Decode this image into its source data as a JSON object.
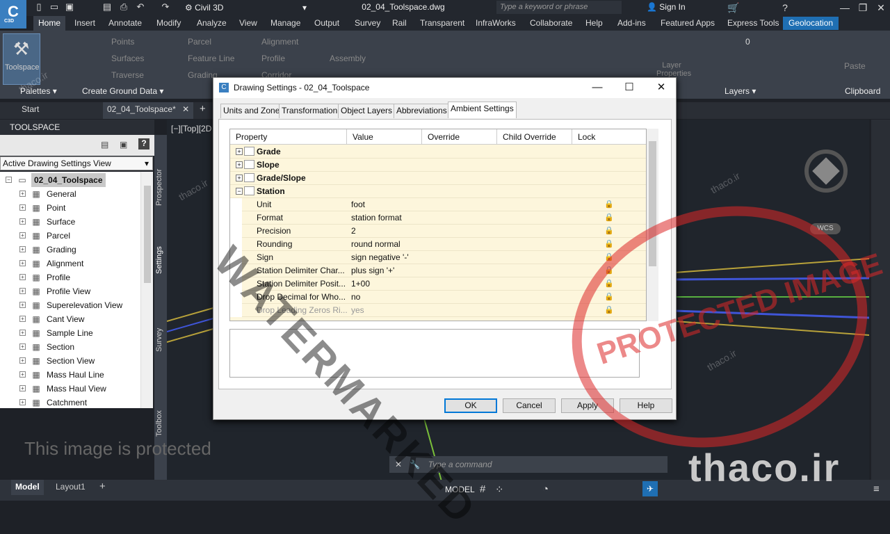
{
  "app": {
    "logo_text": "C",
    "logo_sub": "C3D",
    "workspace": "Civil 3D",
    "doc_title": "02_04_Toolspace.dwg",
    "search_placeholder": "Type a keyword or phrase",
    "sign_in": "Sign In"
  },
  "ribbon_tabs": [
    "Home",
    "Insert",
    "Annotate",
    "Modify",
    "Analyze",
    "View",
    "Manage",
    "Output",
    "Survey",
    "Rail",
    "Transparent",
    "InfraWorks",
    "Collaborate",
    "Help",
    "Add-ins",
    "Featured Apps",
    "Express Tools",
    "Geolocation"
  ],
  "ribbon": {
    "toolspace": "Toolspace",
    "points": "Points",
    "surfaces": "Surfaces",
    "traverse": "Traverse",
    "parcel": "Parcel",
    "feature_line": "Feature Line",
    "grading": "Grading",
    "alignment": "Alignment",
    "profile": "Profile",
    "corridor": "Corridor",
    "assembly": "Assembly",
    "layer_props": "Layer Properties",
    "layer_num": "0",
    "paste": "Paste",
    "panels": {
      "palettes": "Palettes",
      "create_ground": "Create Ground Data",
      "layers": "Layers",
      "clipboard": "Clipboard"
    }
  },
  "doc_tabs": {
    "start": "Start",
    "active": "02_04_Toolspace*"
  },
  "viewport_label": "[−][Top][2D",
  "toolspace": {
    "title": "TOOLSPACE",
    "view": "Active Drawing Settings View",
    "root": "02_04_Toolspace",
    "items": [
      "General",
      "Point",
      "Surface",
      "Parcel",
      "Grading",
      "Alignment",
      "Profile",
      "Profile View",
      "Superelevation View",
      "Cant View",
      "Sample Line",
      "Section",
      "Section View",
      "Mass Haul Line",
      "Mass Haul View",
      "Catchment"
    ],
    "side_tabs": [
      "Prospector",
      "Settings",
      "Survey",
      "Toolbox"
    ]
  },
  "dialog": {
    "title": "Drawing Settings - 02_04_Toolspace",
    "tabs": [
      "Units and Zone",
      "Transformation",
      "Object Layers",
      "Abbreviations",
      "Ambient Settings"
    ],
    "columns": [
      "Property",
      "Value",
      "Override",
      "Child Override",
      "Lock"
    ],
    "rows": [
      {
        "property": "Grade",
        "value": "",
        "header": true
      },
      {
        "property": "Slope",
        "value": "",
        "header": true
      },
      {
        "property": "Grade/Slope",
        "value": "",
        "header": true
      },
      {
        "property": "Station",
        "value": "",
        "header": true,
        "expanded": true
      },
      {
        "property": "Unit",
        "value": "foot"
      },
      {
        "property": "Format",
        "value": "station format"
      },
      {
        "property": "Precision",
        "value": "2"
      },
      {
        "property": "Rounding",
        "value": "round normal"
      },
      {
        "property": "Sign",
        "value": "sign negative '-'"
      },
      {
        "property": "Station Delimiter Char...",
        "value": "plus sign '+'"
      },
      {
        "property": "Station Delimiter Posit...",
        "value": "1+00"
      },
      {
        "property": "Drop Decimal for Who...",
        "value": "no"
      },
      {
        "property": "Drop Leading Zeros Ri...",
        "value": "yes",
        "dim": true
      }
    ],
    "buttons": {
      "ok": "OK",
      "cancel": "Cancel",
      "apply": "Apply",
      "help": "Help"
    }
  },
  "command_placeholder": "Type a command",
  "status": {
    "model_tab": "Model",
    "layout_tab": "Layout1",
    "model_btn": "MODEL"
  },
  "overlay": {
    "protected": "This image is protected",
    "watermark": "WATERMARKED",
    "stamp": "PROTECTED IMAGE",
    "brand": "thaco.ir",
    "small": "thaco.ir"
  },
  "colors": {
    "accent": "#1f6fb3",
    "ribbon_bg": "#3b414b",
    "grid_row": "#fdf6dc"
  }
}
